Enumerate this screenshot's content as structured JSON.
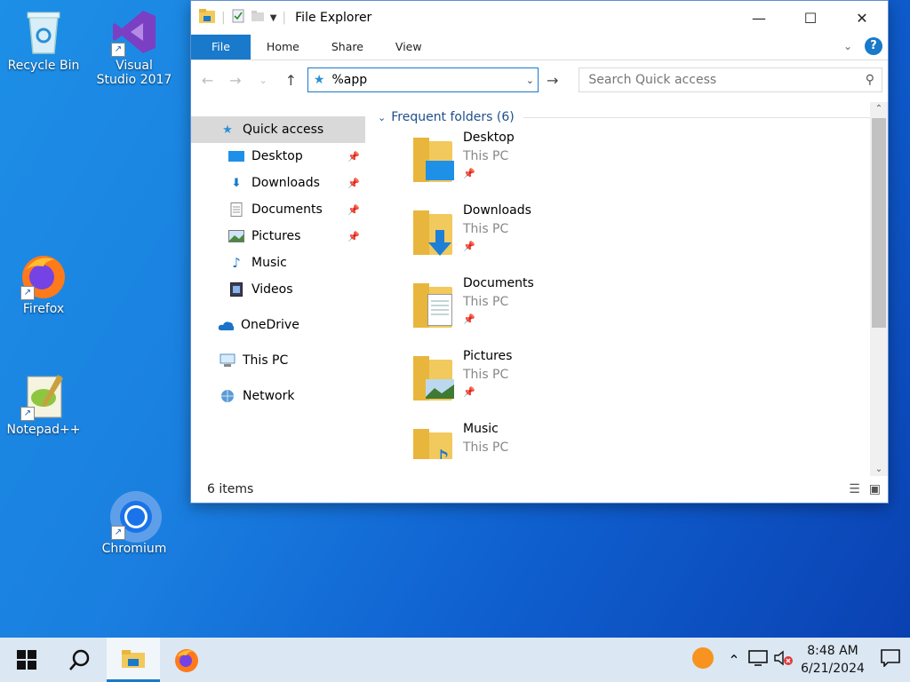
{
  "desktop": {
    "icons": [
      {
        "label": "Recycle Bin"
      },
      {
        "label": "Visual Studio 2017"
      },
      {
        "label": "Firefox"
      },
      {
        "label": "Notepad++"
      },
      {
        "label": "Chromium"
      }
    ]
  },
  "window": {
    "title": "File Explorer",
    "ribbon_tabs": [
      "File",
      "Home",
      "Share",
      "View"
    ],
    "address_value": "%app",
    "search_placeholder": "Search Quick access",
    "nav": {
      "quick_access": "Quick access",
      "pinned": [
        "Desktop",
        "Downloads",
        "Documents",
        "Pictures"
      ],
      "unpinned": [
        "Music",
        "Videos"
      ],
      "onedrive": "OneDrive",
      "this_pc": "This PC",
      "network": "Network"
    },
    "group_header": "Frequent folders (6)",
    "folders": [
      {
        "name": "Desktop",
        "location": "This PC"
      },
      {
        "name": "Downloads",
        "location": "This PC"
      },
      {
        "name": "Documents",
        "location": "This PC"
      },
      {
        "name": "Pictures",
        "location": "This PC"
      },
      {
        "name": "Music",
        "location": "This PC"
      }
    ],
    "status": "6 items"
  },
  "taskbar": {
    "time": "8:48 AM",
    "date": "6/21/2024"
  },
  "colors": {
    "accent": "#1979ca",
    "folder": "#f2c95c"
  }
}
